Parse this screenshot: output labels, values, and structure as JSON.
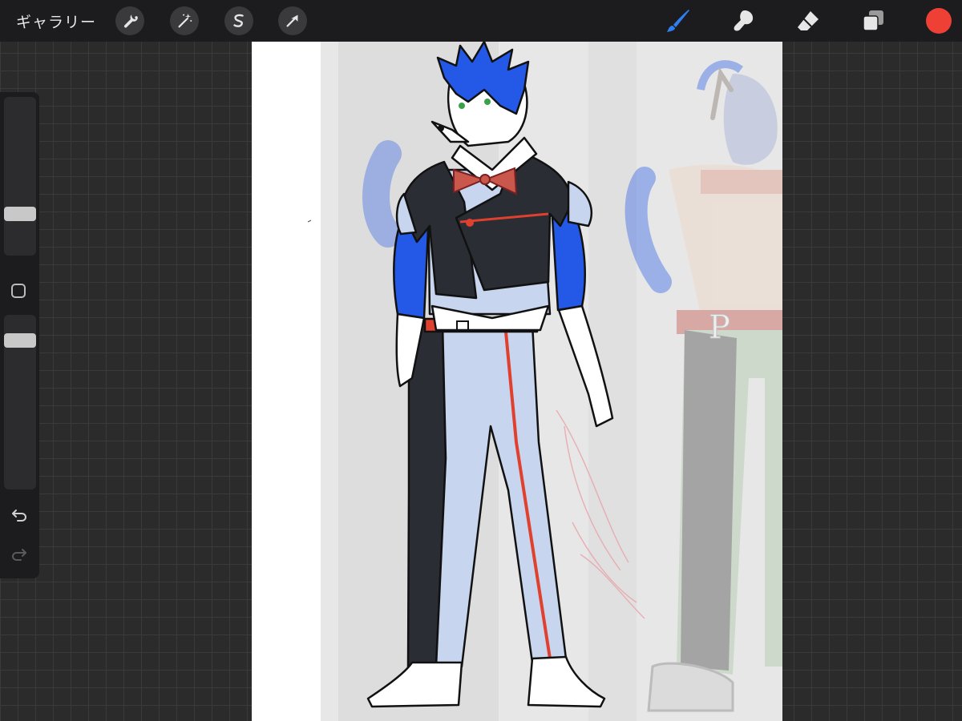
{
  "app": {
    "gallery_label": "ギャラリー"
  },
  "toolbar": {
    "left_tools": [
      "wrench-icon",
      "magic-wand-icon",
      "selection-icon",
      "transform-arrow-icon"
    ],
    "right_tools": [
      "brush-icon",
      "smudge-icon",
      "eraser-icon",
      "layers-icon"
    ],
    "active_tool": "brush",
    "active_color": "#ee4035",
    "accent_color": "#2f7ff2"
  },
  "sidebar": {
    "controls": [
      "brush-size-slider",
      "modify-button",
      "opacity-slider",
      "undo-button",
      "redo-button"
    ]
  },
  "canvas": {
    "content": "character-illustration",
    "colors": {
      "fur_blue": "#2458e6",
      "jacket": "#2a2d33",
      "pants_light": "#c8d5ee",
      "accent_red": "#e0402e",
      "reference_gray": "#e4e5e4"
    }
  }
}
